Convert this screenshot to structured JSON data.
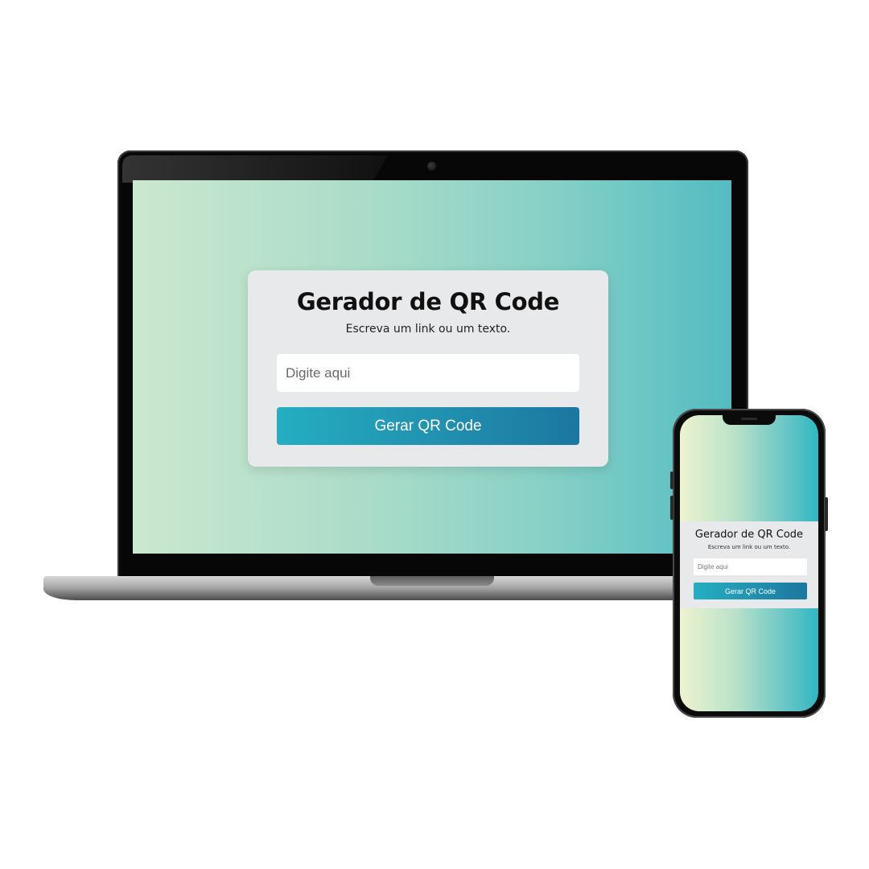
{
  "desktop": {
    "title": "Gerador de QR Code",
    "subtitle": "Escreva um link ou um texto.",
    "input": {
      "placeholder": "Digite aqui",
      "value": ""
    },
    "button_label": "Gerar QR Code"
  },
  "mobile": {
    "title": "Gerador de QR Code",
    "subtitle": "Escreva um link ou um texto.",
    "input": {
      "placeholder": "Digite aqui",
      "value": ""
    },
    "button_label": "Gerar QR Code"
  },
  "colors": {
    "button_gradient_start": "#25aec1",
    "button_gradient_end": "#1c77a0",
    "card_background": "#e8e9eb",
    "desktop_bg_left": "#cbe7cf",
    "desktop_bg_right": "#53bcc2",
    "mobile_bg_left": "#eef3cf",
    "mobile_bg_right": "#2fb7c2"
  }
}
